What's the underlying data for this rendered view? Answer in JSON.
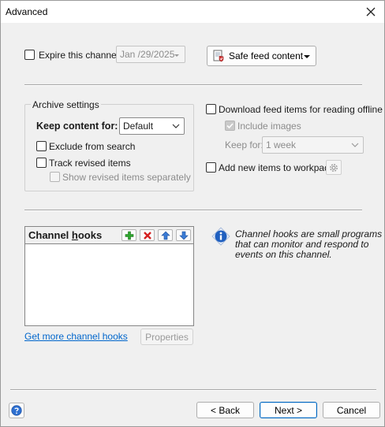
{
  "window": {
    "title": "Advanced"
  },
  "expire": {
    "label": "Expire this channel:",
    "date": "Jan /29/2025"
  },
  "safe_feed": {
    "label": "Safe feed content"
  },
  "archive": {
    "group_label": "Archive settings",
    "keep_label": "Keep content for:",
    "keep_value": "Default",
    "exclude_label": "Exclude from search",
    "track_label": "Track revised items",
    "show_revised_label": "Show revised items separately"
  },
  "offline": {
    "download_label": "Download feed items for reading offline",
    "include_images_label": "Include images",
    "keep_for_label": "Keep for:",
    "keep_for_value": "1 week",
    "workpads_label": "Add new items to workpads"
  },
  "hooks": {
    "title_pre": "Channel ",
    "title_accel": "h",
    "title_post": "ooks",
    "get_more_link": "Get more channel hooks",
    "properties_label": "Properties",
    "info_line1": "Channel hooks are small programs",
    "info_line2": "that can monitor and respond to",
    "info_line3": "events on this channel."
  },
  "footer": {
    "back": "< Back",
    "next": "Next >",
    "cancel": "Cancel"
  },
  "colors": {
    "accent": "#0067c0",
    "link": "#0066cc",
    "info_blue": "#1f5fbf"
  }
}
